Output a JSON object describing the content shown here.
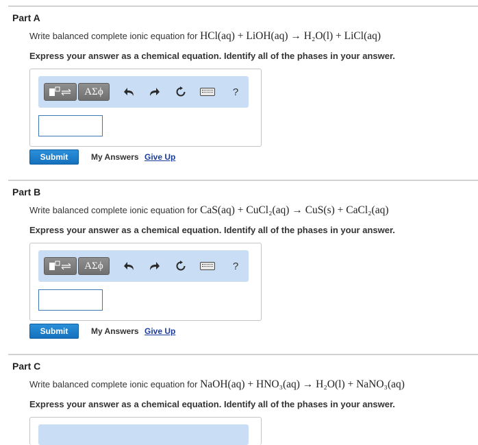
{
  "parts": [
    {
      "title": "Part A",
      "question_prefix": "Write balanced complete ionic equation for",
      "equation": "HCl(aq) + LiOH(aq) → H₂O(l) + LiCl(aq)",
      "instruction": "Express your answer as a chemical equation. Identify all of the phases in your answer."
    },
    {
      "title": "Part B",
      "question_prefix": "Write balanced complete ionic equation for",
      "equation": "CaS(aq) + CuCl₂(aq) → CuS(s) + CaCl₂(aq)",
      "instruction": "Express your answer as a chemical equation. Identify all of the phases in your answer."
    },
    {
      "title": "Part C",
      "question_prefix": "Write balanced complete ionic equation for",
      "equation": "NaOH(aq) + HNO₃(aq) → H₂O(l) + NaNO₃(aq)",
      "instruction": "Express your answer as a chemical equation. Identify all of the phases in your answer."
    }
  ],
  "toolbar": {
    "symbols_label": "ΑΣϕ",
    "undo_icon": "undo-arrow-icon",
    "redo_icon": "redo-arrow-icon",
    "reset_icon": "reset-icon",
    "keyboard_icon": "keyboard-icon",
    "help_label": "?"
  },
  "actions": {
    "submit_label": "Submit",
    "my_answers_label": "My Answers",
    "give_up_label": "Give Up"
  },
  "colors": {
    "submit": "#1a7fcf",
    "toolbar_bg": "#c9def5",
    "link": "#1a3d9c"
  }
}
